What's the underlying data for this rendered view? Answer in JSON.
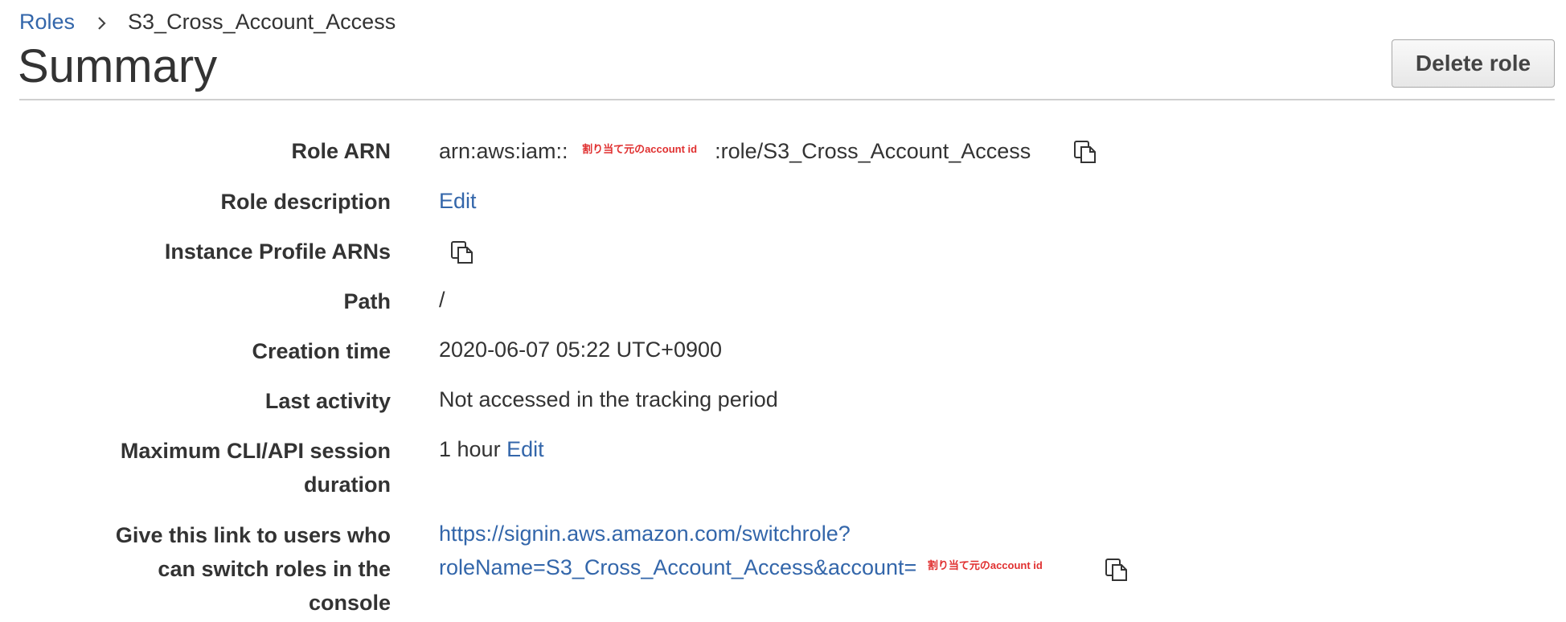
{
  "breadcrumb": {
    "parent": "Roles",
    "current": "S3_Cross_Account_Access"
  },
  "header": {
    "title": "Summary",
    "delete_label": "Delete role"
  },
  "summary": {
    "role_arn": {
      "label": "Role ARN",
      "prefix": "arn:aws:iam::",
      "redacted": "割り当て元のaccount id",
      "suffix": ":role/S3_Cross_Account_Access"
    },
    "role_description": {
      "label": "Role description",
      "edit": "Edit"
    },
    "instance_profile": {
      "label": "Instance Profile ARNs"
    },
    "path": {
      "label": "Path",
      "value": "/"
    },
    "creation_time": {
      "label": "Creation time",
      "value": "2020-06-07 05:22 UTC+0900"
    },
    "last_activity": {
      "label": "Last activity",
      "value": "Not accessed in the tracking period"
    },
    "max_session": {
      "label_line1": "Maximum CLI/API session",
      "label_line2": "duration",
      "value": "1 hour",
      "edit": "Edit"
    },
    "switch_link": {
      "label_line1": "Give this link to users who",
      "label_line2": "can switch roles in the",
      "label_line3": "console",
      "url_line1": "https://signin.aws.amazon.com/switchrole?",
      "url_line2": "roleName=S3_Cross_Account_Access&account=",
      "redacted": "割り当て元のaccount id"
    }
  },
  "colors": {
    "link": "#3366aa",
    "text": "#333333",
    "redaction": "#e03030"
  },
  "icons": {
    "copy": "copy-icon",
    "breadcrumb_separator": "chevron-right-icon"
  }
}
